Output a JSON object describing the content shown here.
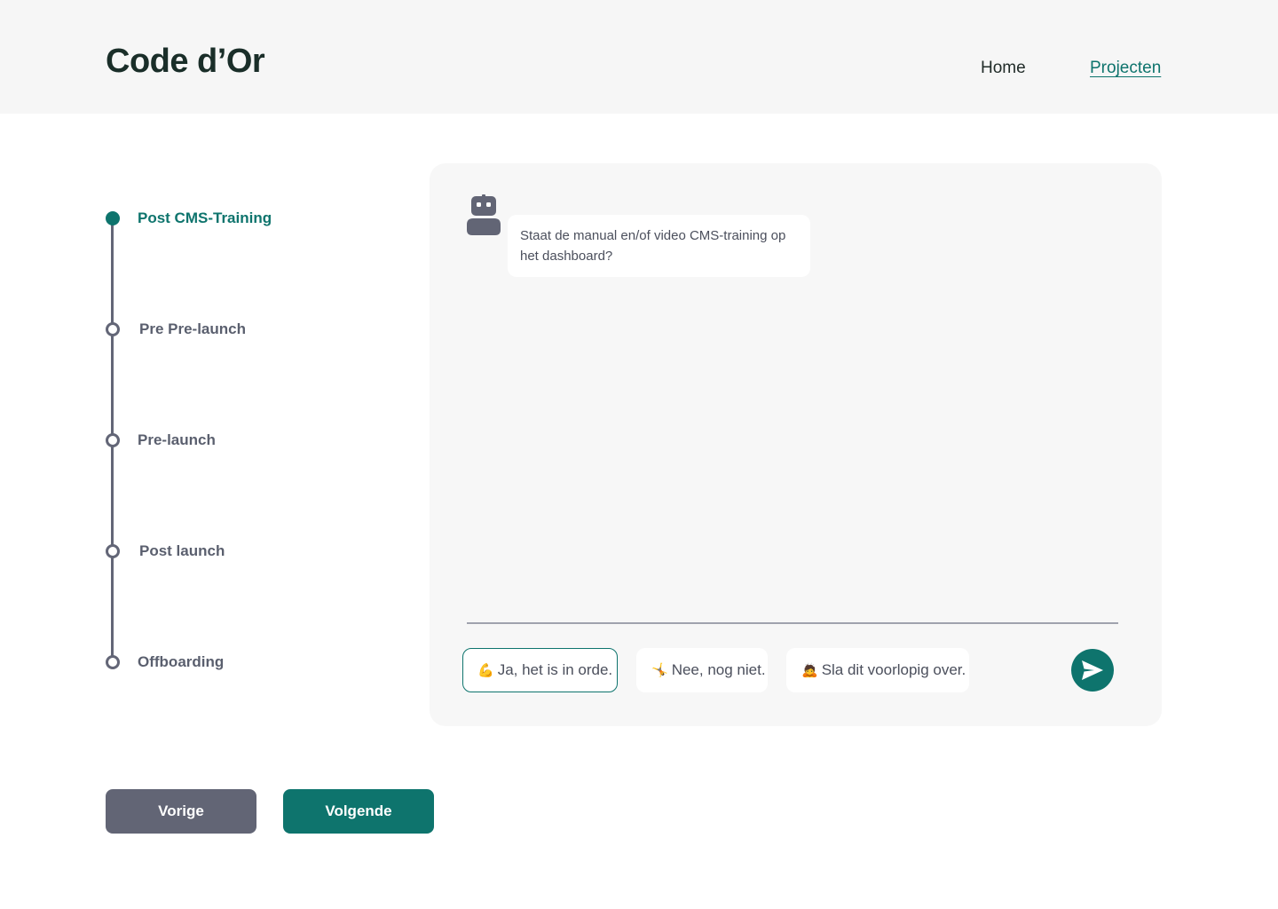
{
  "header": {
    "logo": "Code d’Or",
    "nav": {
      "home": "Home",
      "projects": "Projecten"
    }
  },
  "stepper": {
    "steps": [
      {
        "label": "Post CMS-Training",
        "active": true
      },
      {
        "label": "Pre Pre-launch",
        "active": false
      },
      {
        "label": "Pre-launch",
        "active": false
      },
      {
        "label": "Post launch",
        "active": false
      },
      {
        "label": "Offboarding",
        "active": false
      }
    ]
  },
  "chat": {
    "bot_message": "Staat de manual en/of video CMS-training op het dashboard?",
    "choices": [
      {
        "emoji": "💪",
        "label": "Ja, het is in orde.",
        "selected": true
      },
      {
        "emoji": "🤸",
        "label": "Nee, nog niet.",
        "selected": false
      },
      {
        "emoji": "🙇",
        "label": "Sla dit voorlopig over.",
        "selected": false
      }
    ],
    "send_icon": "send-icon"
  },
  "footer": {
    "prev_label": "Vorige",
    "next_label": "Volgende"
  },
  "colors": {
    "accent": "#0e746d",
    "muted": "#626575",
    "panel": "#f7f7f7"
  }
}
